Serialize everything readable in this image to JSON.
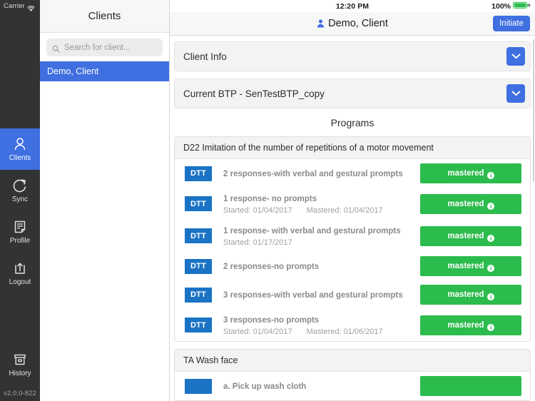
{
  "rail": {
    "carrier": "Carrier",
    "wifi_icon": "wifi-icon",
    "items": [
      {
        "label": "Clients",
        "icon": "person-icon",
        "active": true
      },
      {
        "label": "Sync",
        "icon": "refresh-icon",
        "active": false
      },
      {
        "label": "Profile",
        "icon": "document-icon",
        "active": false
      },
      {
        "label": "Logout",
        "icon": "export-box-icon",
        "active": false
      }
    ],
    "bottom_item": {
      "label": "History",
      "icon": "archive-box-icon"
    },
    "version": "v2.0.0-822"
  },
  "clients_pane": {
    "header": "Clients",
    "search": {
      "placeholder": "Search for client...",
      "value": "",
      "icon": "search-icon"
    },
    "list": [
      {
        "name": "Demo, Client",
        "selected": true
      }
    ]
  },
  "statusbar": {
    "time": "12:20 PM",
    "battery_percent": "100%",
    "battery_icon": "battery-full-charging-icon"
  },
  "navbar": {
    "client_icon": "person-icon",
    "title": "Demo, Client",
    "initiate_label": "Initiate"
  },
  "accordions": [
    {
      "title": "Client Info",
      "chevron": "chevron-down-icon"
    },
    {
      "title": "Current BTP - SenTestBTP_copy",
      "chevron": "chevron-down-icon"
    }
  ],
  "programs_heading": "Programs",
  "cards": [
    {
      "title": "D22 Imitation of the number of repetitions of a motor movement",
      "rows": [
        {
          "badge": "DTT",
          "name": "2 responses-with verbal and gestural prompts",
          "started": "",
          "mastered": "",
          "status": "mastered",
          "status_color": "#2cbc4d",
          "info_icon": "info-icon"
        },
        {
          "badge": "DTT",
          "name": "1 response- no prompts",
          "started": "Started: 01/04/2017",
          "mastered": "Mastered: 01/04/2017",
          "status": "mastered",
          "status_color": "#2cbc4d",
          "info_icon": "info-icon"
        },
        {
          "badge": "DTT",
          "name": "1 response- with verbal and gestural prompts",
          "started": "Started: 01/17/2017",
          "mastered": "",
          "status": "mastered",
          "status_color": "#2cbc4d",
          "info_icon": "info-icon"
        },
        {
          "badge": "DTT",
          "name": "2 responses-no prompts",
          "started": "",
          "mastered": "",
          "status": "mastered",
          "status_color": "#2cbc4d",
          "info_icon": "info-icon"
        },
        {
          "badge": "DTT",
          "name": "3 responses-with verbal and gestural prompts",
          "started": "",
          "mastered": "",
          "status": "mastered",
          "status_color": "#2cbc4d",
          "info_icon": "info-icon"
        },
        {
          "badge": "DTT",
          "name": "3 responses-no prompts",
          "started": "Started: 01/04/2017",
          "mastered": "Mastered: 01/06/2017",
          "status": "mastered",
          "status_color": "#2cbc4d",
          "info_icon": "info-icon"
        }
      ]
    },
    {
      "title": "TA Wash face",
      "rows": [
        {
          "badge": "",
          "name": "a. Pick up wash cloth",
          "started": "",
          "mastered": "",
          "status": "",
          "status_color": "#2cbc4d",
          "info_icon": "info-icon"
        }
      ]
    }
  ],
  "colors": {
    "accent_blue": "#3f6fe0",
    "badge_blue": "#1a73c4",
    "status_green": "#2cbc4d",
    "rail_dark": "#333333"
  }
}
